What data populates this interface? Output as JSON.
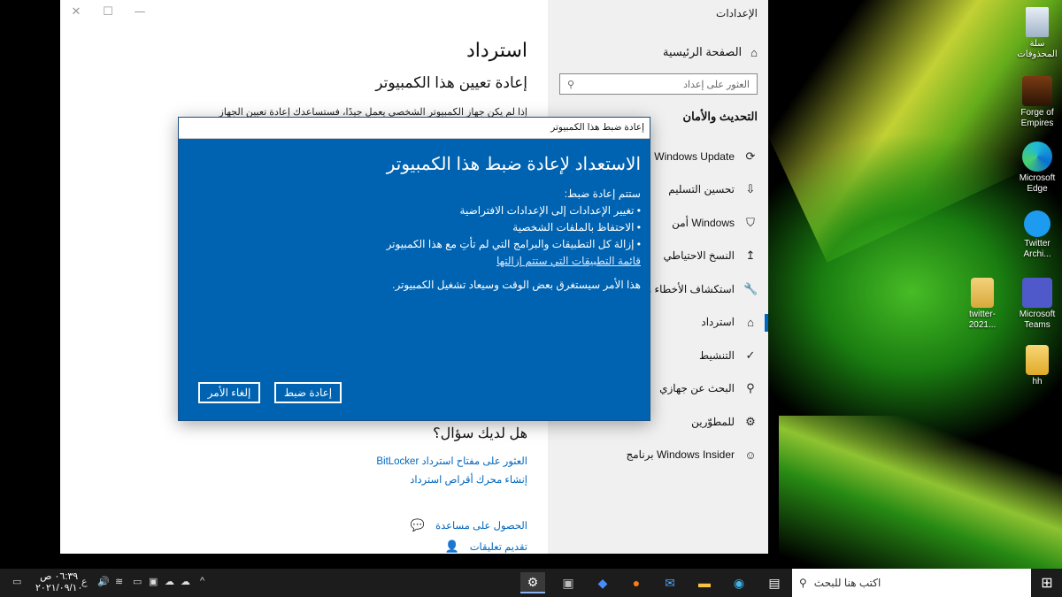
{
  "window": {
    "app_title": "الإعدادات",
    "controls": {
      "minimize": "—",
      "maximize": "☐",
      "close": "✕"
    }
  },
  "sidebar": {
    "home_label": "الصفحة الرئيسية",
    "search_placeholder": "العثور على إعداد",
    "section_title": "التحديث والأمان",
    "items": [
      {
        "label": "Windows Update",
        "icon": "refresh-icon",
        "glyph": "⟳"
      },
      {
        "label": "تحسين التسليم",
        "icon": "delivery-icon",
        "glyph": "⇩"
      },
      {
        "label": "أمن Windows",
        "icon": "shield-icon",
        "glyph": "⛉"
      },
      {
        "label": "النسخ الاحتياطي",
        "icon": "backup-icon",
        "glyph": "↥"
      },
      {
        "label": "استكشاف الأخطاء وإصلاحها",
        "icon": "wrench-icon",
        "glyph": "🔧"
      },
      {
        "label": "استرداد",
        "icon": "recovery-icon",
        "glyph": "⌂"
      },
      {
        "label": "التنشيط",
        "icon": "check-circle-icon",
        "glyph": "✓"
      },
      {
        "label": "البحث عن جهازي",
        "icon": "find-device-icon",
        "glyph": "⚲"
      },
      {
        "label": "للمطوّرين",
        "icon": "developer-icon",
        "glyph": "⚙"
      },
      {
        "label": "برنامج Windows Insider",
        "icon": "insider-icon",
        "glyph": "☺"
      }
    ]
  },
  "main": {
    "title": "استرداد",
    "subtitle": "إعادة تعيين هذا الكمبيوتر",
    "paragraph": "إذا لم يكن جهاز الكمبيوتر الشخصي يعمل جيدًا، فستساعدك إعادة تعيين الجهاز",
    "question": "هل لديك سؤال؟",
    "links": [
      "العثور على مفتاح استرداد BitLocker",
      "إنشاء محرك أقراص استرداد"
    ],
    "help": [
      {
        "label": "الحصول على مساعدة",
        "icon": "help-chat-icon"
      },
      {
        "label": "تقديم تعليقات",
        "icon": "feedback-icon"
      }
    ]
  },
  "dialog": {
    "titlebar": "إعادة ضبط هذا الكمبيوتر",
    "heading": "الاستعداد لإعادة ضبط هذا الكمبيوتر",
    "intro": "ستتم إعادة ضبط:",
    "bullets": [
      "• تغيير الإعدادات إلى الإعدادات الافتراضية",
      "• الاحتفاظ بالملفات الشخصية",
      "• إزالة كل التطبيقات والبرامج التي لم تأتِ مع هذا الكمبيوتر"
    ],
    "apps_link": "قائمة التطبيقات التي ستتم إزالتها",
    "note": "هذا الأمر سيستغرق بعض الوقت وسيعاد تشغيل الكمبيوتر.",
    "reset_button": "إعادة ضبط",
    "cancel_button": "إلغاء الأمر"
  },
  "desktop_icons": [
    {
      "label": "سلة المحذوفات",
      "icon": "recycle-bin-icon"
    },
    {
      "label": "Forge of Empires",
      "icon": "forge-of-empires-icon"
    },
    {
      "label": "Microsoft Edge",
      "icon": "edge-icon"
    },
    {
      "label": "Twitter Archi...",
      "icon": "twitter-icon"
    },
    {
      "label": "twitter-2021...",
      "icon": "zip-folder-icon"
    },
    {
      "label": "Microsoft Teams",
      "icon": "teams-icon"
    },
    {
      "label": "hh",
      "icon": "folder-icon"
    }
  ],
  "taskbar": {
    "search_placeholder": "اكتب هنا للبحث",
    "time": "٠٦:٣٩ ص",
    "date": "٢٠٢١/٠٩/١٠",
    "lang": "ع",
    "colors": {
      "bg": "#1c1c1c",
      "accent": "#0063b1"
    }
  }
}
